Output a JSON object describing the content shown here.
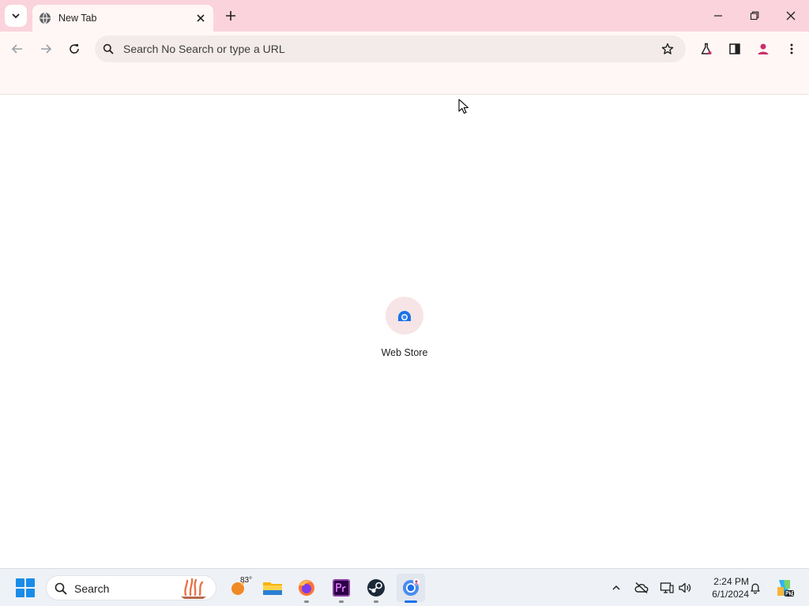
{
  "browser": {
    "tab": {
      "title": "New Tab"
    },
    "omnibox": {
      "placeholder": "Search No Search or type a URL"
    }
  },
  "content": {
    "shortcuts": [
      {
        "label": "Web Store"
      }
    ]
  },
  "taskbar": {
    "search_label": "Search",
    "weather_temp": "83°",
    "clock": {
      "time": "2:24 PM",
      "date": "6/1/2024"
    }
  },
  "colors": {
    "tabstrip_bg": "#fbd3dd",
    "toolbar_bg": "#fff7f5",
    "omnibox_bg": "#f3ebea",
    "taskbar_bg": "#eef1f6",
    "accent": "#1a73e8"
  }
}
